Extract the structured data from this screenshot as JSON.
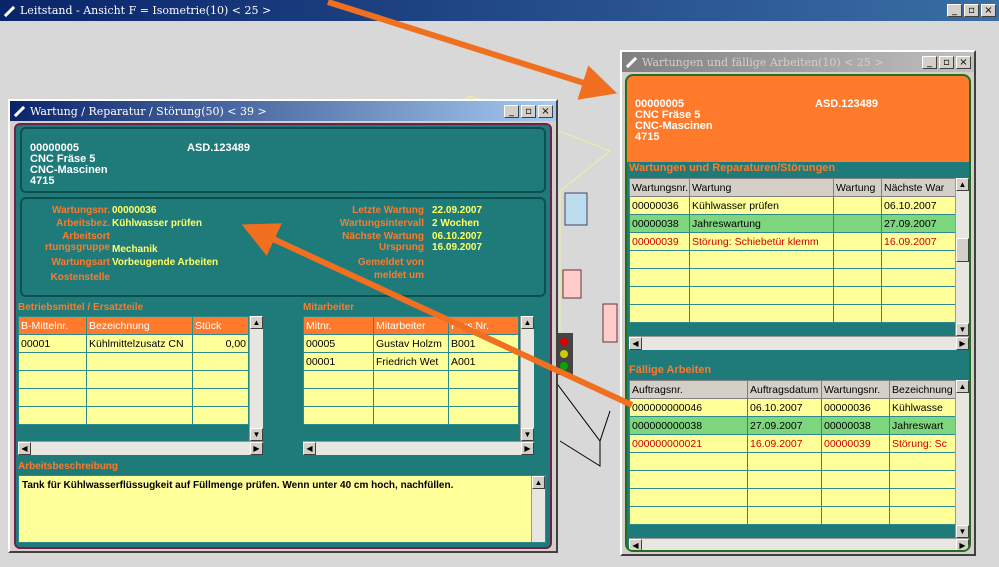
{
  "colors": {
    "accent": "#ff7a2a",
    "panel": "#1f7a7a",
    "row_green": "#7dd67d",
    "row_yellow": "#ffff99",
    "row_red_text": "#cc0000"
  },
  "main": {
    "title": "Leitstand - Ansicht F = Isometrie(10)  < 25 >",
    "min": "_",
    "max": "▫",
    "close": "×"
  },
  "left": {
    "title": "Wartung / Reparatur / Störung(50)  < 39 >",
    "header": {
      "line1": "00000005",
      "code": "ASD.123489",
      "line2": "CNC Fräse 5",
      "line3": "CNC-Mascinen",
      "line4": "4715"
    },
    "fields": {
      "wartungsnr_label": "Wartungsnr.",
      "wartungsnr": "00000036",
      "arbeitsbez_label": "Arbeitsbez.",
      "arbeitsbez": "Kühlwasser prüfen",
      "arbeitsort_label": "Arbeitsort",
      "gruppe_label": "rtungsgruppe",
      "gruppe": "Mechanik",
      "wartungsart_label": "Wartungsart",
      "wartungsart": "Vorbeugende Arbeiten",
      "kostenstelle_label": "Kostenstelle",
      "letzte_label": "Letzte Wartung",
      "letzte": "22.09.2007",
      "intervall_label": "Wartungsintervall",
      "intervall": "2  Wochen",
      "naechste_label": "Nächste Wartung",
      "naechste": "06.10.2007",
      "ursprung_label": "Ursprung",
      "ursprung": "16.09.2007",
      "gemeldet_von_label": "Gemeldet von",
      "gemeldet_um_label": "meldet um"
    },
    "betrieb": {
      "title": "Betriebsmittel / Ersatzteile",
      "headers": [
        "B-Mittelnr.",
        "Bezeichnung",
        "Stück"
      ],
      "rows": [
        [
          "00001",
          "Kühlmittelzusatz CN",
          "0,00"
        ]
      ]
    },
    "mitarbeiter": {
      "title": "Mitarbeiter",
      "headers": [
        "Mitnr.",
        "Mitarbeiter",
        "Pers.Nr."
      ],
      "rows": [
        [
          "00005",
          "Gustav Holzm",
          "B001"
        ],
        [
          "00001",
          "Friedrich Wet",
          "A001"
        ]
      ]
    },
    "beschreibung": {
      "title": "Arbeitsbeschreibung",
      "text": "Tank für Kühlwasserflüssugkeit auf Füllmenge prüfen. Wenn unter 40 cm hoch, nachfüllen."
    }
  },
  "right": {
    "title": "Wartungen und fällige Arbeiten(10)  < 25 >",
    "header": {
      "line1": "00000005",
      "code": "ASD.123489",
      "line2": "CNC Fräse 5",
      "line3": "CNC-Mascinen",
      "line4": "4715"
    },
    "wartungen": {
      "title": "Wartungen und Reparaturen/Störungen",
      "headers": [
        "Wartungsnr.",
        "Wartung",
        "Wartung",
        "Nächste War"
      ],
      "rows": [
        [
          "00000036",
          "Kühlwasser prüfen",
          "",
          "06.10.2007"
        ],
        [
          "00000038",
          "Jahreswartung",
          "",
          "27.09.2007"
        ],
        [
          "00000039",
          "Störung: Schiebetür klemm",
          "",
          "16.09.2007"
        ]
      ]
    },
    "faellig": {
      "title": "Fällige Arbeiten",
      "headers": [
        "Auftragsnr.",
        "Auftragsdatum",
        "Wartungsnr.",
        "Bezeichnung"
      ],
      "rows": [
        [
          "000000000046",
          "06.10.2007",
          "00000036",
          "Kühlwasse"
        ],
        [
          "000000000038",
          "27.09.2007",
          "00000038",
          "Jahreswart"
        ],
        [
          "000000000021",
          "16.09.2007",
          "00000039",
          "Störung: Sc"
        ]
      ]
    }
  }
}
